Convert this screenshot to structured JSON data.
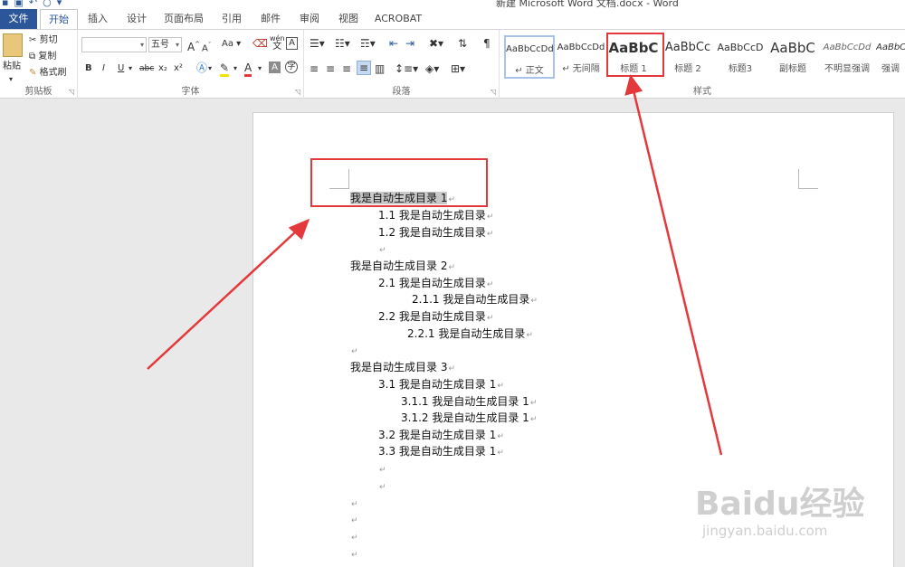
{
  "window": {
    "title": "新建 Microsoft Word 文档.docx - Word"
  },
  "tabs": [
    "文件",
    "开始",
    "插入",
    "设计",
    "页面布局",
    "引用",
    "邮件",
    "审阅",
    "视图",
    "ACROBAT"
  ],
  "clipboard": {
    "paste": "粘贴",
    "cut": "剪切",
    "copy": "复制",
    "format_painter": "格式刷",
    "label": "剪贴板"
  },
  "font": {
    "name_value": "",
    "size_value": "五号",
    "label": "字体",
    "bold": "B",
    "italic": "I",
    "underline": "U",
    "strike": "abc",
    "sub": "x₂",
    "sup": "x²",
    "grow": "A",
    "shrink": "A",
    "case": "Aa",
    "phonetic": "wén",
    "pinyin_char": "文"
  },
  "paragraph": {
    "label": "段落"
  },
  "styles": {
    "label": "样式",
    "items": [
      {
        "sample": "AaBbCcDd",
        "name": "正文"
      },
      {
        "sample": "AaBbCcDd",
        "name": "无间隔"
      },
      {
        "sample": "AaBbC",
        "name": "标题 1"
      },
      {
        "sample": "AaBbCc",
        "name": "标题 2"
      },
      {
        "sample": "AaBbCcD",
        "name": "标题3"
      },
      {
        "sample": "AaBbC",
        "name": "副标题"
      },
      {
        "sample": "AaBbCcDd",
        "name": "不明显强调"
      },
      {
        "sample": "AaBbC",
        "name": "强调"
      }
    ]
  },
  "document": {
    "lines": [
      {
        "text": "我是自动生成目录 1"
      },
      {
        "text": "1.1 我是自动生成目录"
      },
      {
        "text": "1.2 我是自动生成目录"
      },
      {
        "text": ""
      },
      {
        "text": "我是自动生成目录 2"
      },
      {
        "text": "2.1 我是自动生成目录"
      },
      {
        "text": "2.1.1 我是自动生成目录"
      },
      {
        "text": "2.2 我是自动生成目录"
      },
      {
        "text": "2.2.1 我是自动生成目录"
      },
      {
        "text": ""
      },
      {
        "text": "我是自动生成目录 3"
      },
      {
        "text": "3.1 我是自动生成目录 1"
      },
      {
        "text": "3.1.1 我是自动生成目录 1"
      },
      {
        "text": "3.1.2 我是自动生成目录 1"
      },
      {
        "text": "3.2 我是自动生成目录 1"
      },
      {
        "text": "3.3 我是自动生成目录 1"
      },
      {
        "text": ""
      },
      {
        "text": ""
      },
      {
        "text": ""
      },
      {
        "text": ""
      },
      {
        "text": ""
      },
      {
        "text": ""
      }
    ],
    "paragraph_mark": "↵"
  },
  "watermark": {
    "main": "Baidu经验",
    "sub": "jingyan.baidu.com"
  },
  "colors": {
    "accent": "#2b579a",
    "annotation": "#e4393c",
    "highlight": "#c9c9c9"
  }
}
